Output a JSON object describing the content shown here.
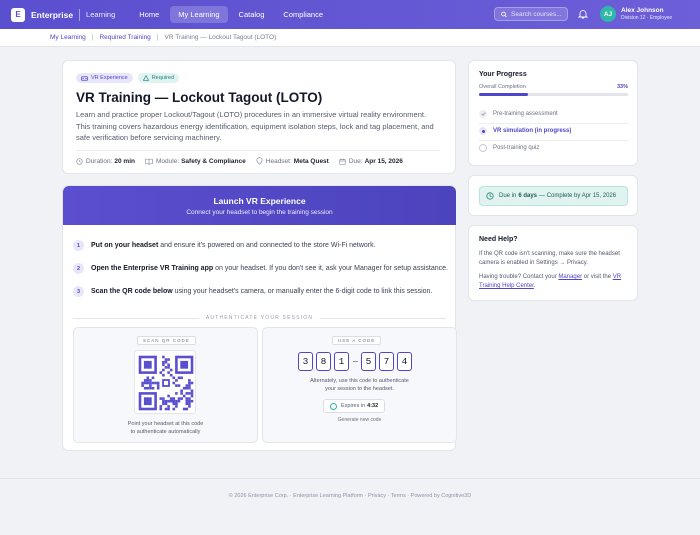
{
  "nav": {
    "brand_letter": "E",
    "brand": "Enterprise",
    "brand_sub": "Learning",
    "links": [
      {
        "label": "Home",
        "active": false
      },
      {
        "label": "My Learning",
        "active": true
      },
      {
        "label": "Catalog",
        "active": false
      },
      {
        "label": "Compliance",
        "active": false
      }
    ],
    "search_placeholder": "Search courses...",
    "user_initials": "AJ",
    "user_name": "Alex Johnson",
    "user_sub": "Division 12 · Employee"
  },
  "breadcrumb": [
    "My Learning",
    "Required Training",
    "VR Training — Lockout Tagout (LOTO)"
  ],
  "course": {
    "badges": [
      "VR Experience",
      "Required"
    ],
    "title": "VR Training — Lockout Tagout (LOTO)",
    "description": "Learn and practice proper Lockout/Tagout (LOTO) procedures in an immersive virtual reality environment. This training covers hazardous energy identification, equipment isolation steps, lock and tag placement, and safe verification before servicing machinery.",
    "meta": [
      {
        "label": "Duration:",
        "value": "20 min",
        "icon": "clock-icon"
      },
      {
        "label": "Module:",
        "value": "Safety & Compliance",
        "icon": "book-icon"
      },
      {
        "label": "Headset:",
        "value": "Meta Quest",
        "icon": "headset-icon"
      },
      {
        "label": "Due:",
        "value": "Apr 15, 2026",
        "icon": "calendar-icon"
      }
    ]
  },
  "launch": {
    "title": "Launch VR Experience",
    "subtitle": "Connect your headset to begin the training session",
    "steps": [
      {
        "num": "1",
        "bold": "Put on your headset",
        "rest": " and ensure it's powered on and connected to the store Wi-Fi network."
      },
      {
        "num": "2",
        "bold": "Open the Enterprise VR Training app",
        "rest": " on your headset. If you don't see it, ask your Manager for setup assistance."
      },
      {
        "num": "3",
        "bold": "Scan the QR code below",
        "rest": " using your headset's camera, or manually enter the 6-digit code to link this session."
      }
    ],
    "auth_label": "AUTHENTICATE YOUR SESSION",
    "qr_label": "SCAN QR CODE",
    "qr_caption_1": "Point your headset at this code",
    "qr_caption_2": "to authenticate automatically",
    "code_label": "USE A CODE",
    "code_digits": [
      "3",
      "8",
      "1",
      "5",
      "7",
      "4"
    ],
    "code_text_1": "Alternately, use this code to authenticate",
    "code_text_2": "your session to the headset.",
    "expires_label": "Expires in",
    "expires_value": "4:32",
    "generate_label": "Generate new code"
  },
  "progress": {
    "title": "Your Progress",
    "overall_label": "Overall Completion",
    "percent_label": "33%",
    "percent": 33,
    "items": [
      {
        "label": "Pre-training assessment",
        "state": "done"
      },
      {
        "label": "VR simulation (in progress)",
        "state": "current"
      },
      {
        "label": "Post-training quiz",
        "state": "todo"
      }
    ]
  },
  "due": {
    "prefix": "Due in",
    "days": "6 days",
    "suffix": "— Complete by Apr 15, 2026"
  },
  "help": {
    "title": "Need Help?",
    "text1": "If the QR code isn't scanning, make sure the headset camera is enabled in Settings → Privacy.",
    "text2_prefix": "Having trouble? Contact your ",
    "manager_link": "Manager",
    "text2_mid": " or visit the ",
    "help_link": "VR Training Help Center",
    "text2_suffix": "."
  },
  "footer": "© 2026 Enterprise Corp. · Enterprise Learning Platform · Privacy · Terms · Powered by Cognitive3D",
  "colors": {
    "accent": "#5a4fcf",
    "teal": "#2fb8a8",
    "page_bg": "#f1f2f6"
  }
}
